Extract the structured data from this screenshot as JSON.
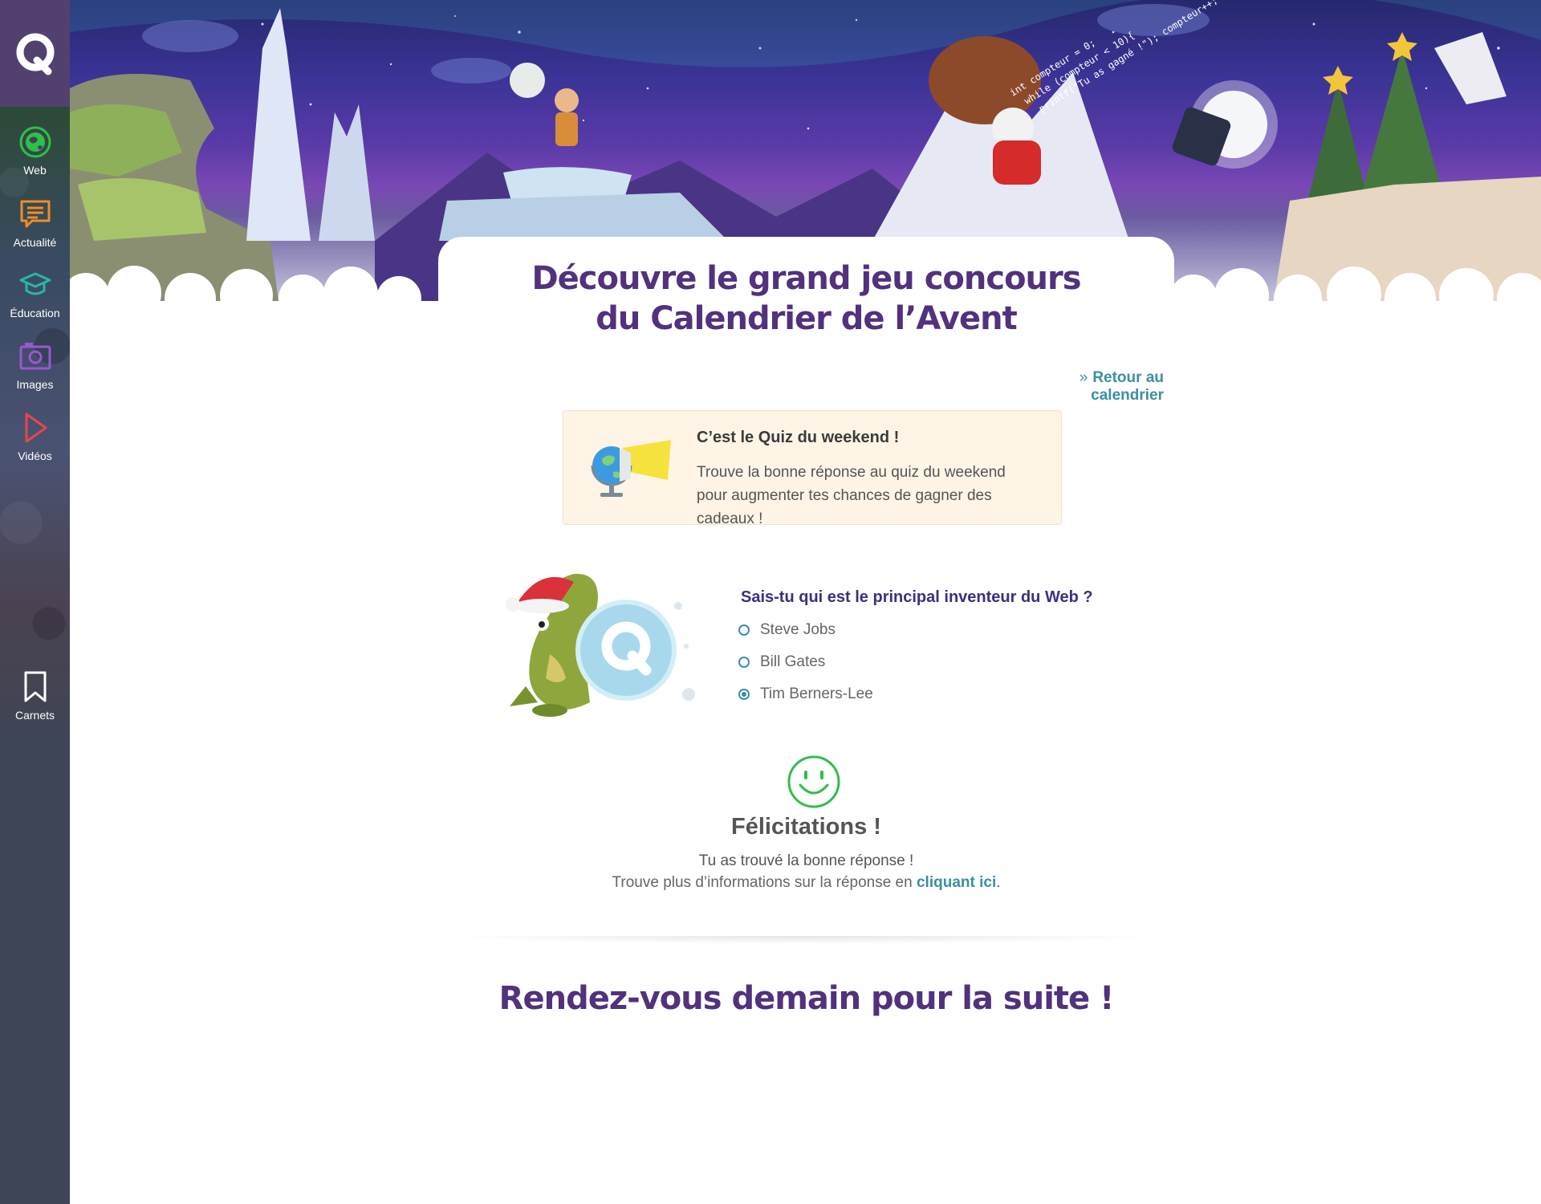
{
  "sidebar": {
    "items": [
      {
        "label": "Web",
        "icon": "web-globe-icon",
        "color": "#2fbf4a"
      },
      {
        "label": "Actualité",
        "icon": "news-icon",
        "color": "#f28c28"
      },
      {
        "label": "Éducation",
        "icon": "graduation-cap-icon",
        "color": "#2bb5a6"
      },
      {
        "label": "Images",
        "icon": "camera-icon",
        "color": "#9b57d3"
      },
      {
        "label": "Vidéos",
        "icon": "play-icon",
        "color": "#e8464b"
      },
      {
        "label": "Carnets",
        "icon": "bookmark-icon",
        "color": "#ffffff"
      }
    ]
  },
  "banner": {
    "code_lines": [
      "int compteur = 0;",
      "while (compteur < 10){",
      "printf(\"Tu as gagné !\"); compteur++;"
    ]
  },
  "main": {
    "title_line1": "Découvre le grand jeu concours",
    "title_line2": "du Calendrier de l’Avent",
    "back_link": "Retour au calendrier"
  },
  "info": {
    "title": "C’est le Quiz du weekend !",
    "text": "Trouve la bonne réponse au quiz du weekend pour augmenter tes chances de gagner des cadeaux !"
  },
  "quiz": {
    "question": "Sais-tu qui est le principal inventeur du Web ?",
    "options": [
      "Steve Jobs",
      "Bill Gates",
      "Tim Berners-Lee"
    ],
    "selected": "Tim Berners-Lee"
  },
  "result": {
    "title": "Félicitations !",
    "line1": "Tu as trouvé la bonne réponse !",
    "line2_prefix": "Trouve plus d’informations sur la réponse en ",
    "link": "cliquant ici",
    "line2_suffix": "."
  },
  "footer": {
    "title": "Rendez-vous demain pour la suite !"
  },
  "colors": {
    "accent": "#3b8fa3",
    "title": "#52317d",
    "question": "#3e2f80",
    "success": "#2fbf4a",
    "sidebar": "#3d4556",
    "info_bg": "#fef5e6"
  }
}
